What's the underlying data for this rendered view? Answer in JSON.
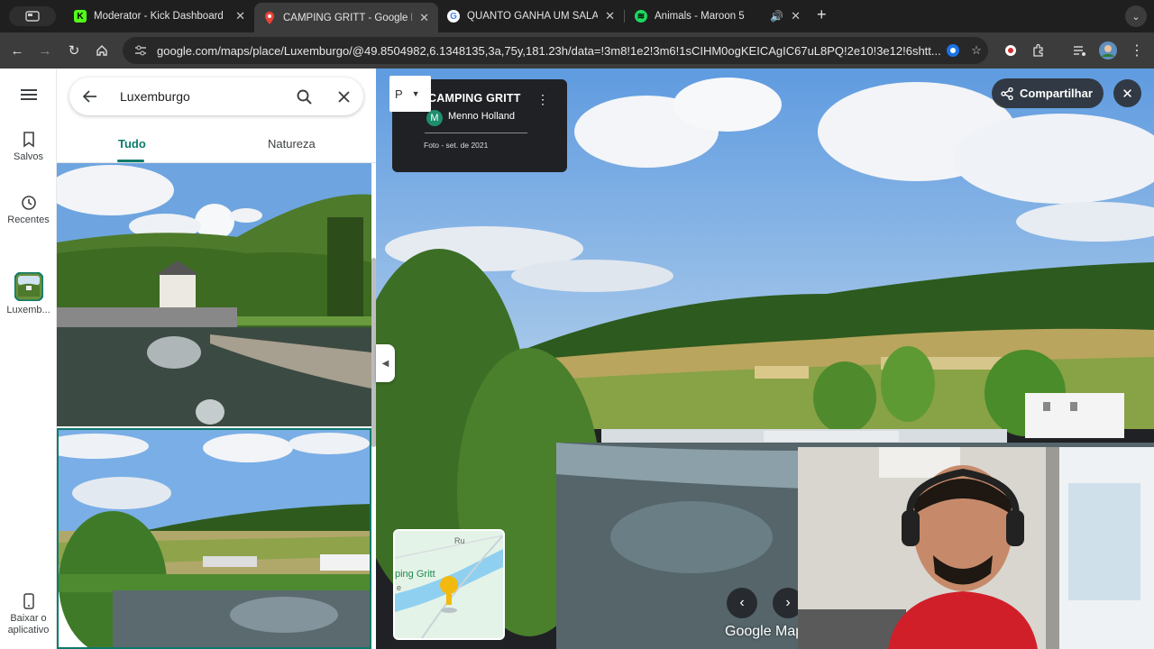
{
  "browser": {
    "tabs": [
      {
        "title": "Moderator - Kick Dashboard",
        "favicon": "kick-logo-icon",
        "active": false
      },
      {
        "title": "CAMPING GRITT - Google Ma",
        "favicon": "google-maps-icon",
        "active": true
      },
      {
        "title": "QUANTO GANHA UM SALAR",
        "favicon": "google-icon",
        "active": false
      },
      {
        "title": "Animals - Maroon 5",
        "favicon": "spotify-icon",
        "active": false,
        "audio": true
      }
    ],
    "new_tab_label": "+",
    "url": "google.com/maps/place/Luxemburgo/@49.8504982,6.1348135,3a,75y,181.23h/data=!3m8!1e2!3m6!1sCIHM0ogKEICAgIC67uL8PQ!2e10!3e12!6shtt..."
  },
  "rail": {
    "items": [
      {
        "label": "Salvos",
        "icon": "bookmark-icon"
      },
      {
        "label": "Recentes",
        "icon": "history-icon"
      },
      {
        "label": "Luxemb..."
      },
      {
        "label": "Baixar o aplicativo",
        "icon": "phone-icon"
      }
    ]
  },
  "search": {
    "query": "Luxemburgo",
    "tabs": [
      "Tudo",
      "Natureza"
    ]
  },
  "photo_card": {
    "title": "CAMPING GRITT",
    "author_initial": "M",
    "author": "Menno Holland",
    "date": "Foto - set. de 2021"
  },
  "actions": {
    "share_label": "Compartilhar"
  },
  "minimap": {
    "place_label": "ping Gritt",
    "road_label": "Ru",
    "road_label2": "e"
  },
  "branding": {
    "logo_text": "Google Map"
  },
  "colors": {
    "accent": "#0b7b6b",
    "chrome_dark": "#1f1f1f",
    "toolbar": "#3c3c3c"
  }
}
